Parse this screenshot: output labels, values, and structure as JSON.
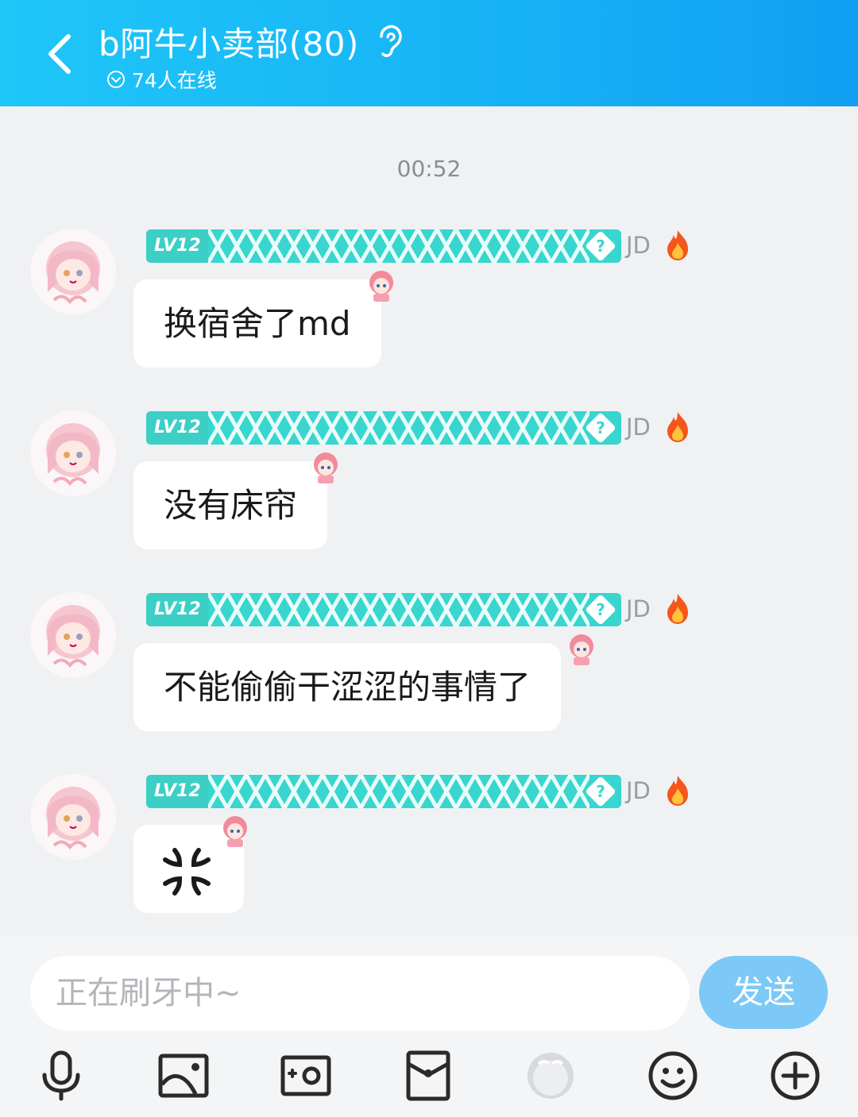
{
  "header": {
    "title": "b阿牛小卖部(80)",
    "online": "74人在线"
  },
  "chat": {
    "timestamp": "00:52",
    "messages": [
      {
        "level": "LV12",
        "sender": "JD",
        "text": "换宿舍了md"
      },
      {
        "level": "LV12",
        "sender": "JD",
        "text": "没有床帘"
      },
      {
        "level": "LV12",
        "sender": "JD",
        "text": "不能偷偷干涩涩的事情了"
      },
      {
        "level": "LV12",
        "sender": "JD",
        "text": "💢"
      }
    ]
  },
  "composer": {
    "placeholder": "正在刷牙中~",
    "send_label": "发送"
  },
  "toolbar": {
    "icons": [
      "microphone-icon",
      "image-icon",
      "camera-icon",
      "red-packet-icon",
      "sticker-icon",
      "emoji-icon",
      "plus-icon"
    ]
  },
  "colors": {
    "header_gradient_start": "#1fc6f8",
    "header_gradient_end": "#129ff2",
    "badge": "#38d6ce",
    "send_button": "#7cc9f7",
    "background": "#f0f1f3"
  }
}
